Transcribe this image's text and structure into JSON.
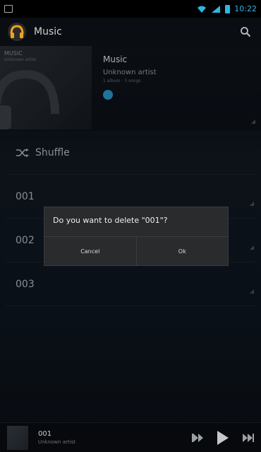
{
  "status": {
    "time": "10:22"
  },
  "actionbar": {
    "title": "Music"
  },
  "album": {
    "art_title": "MUSIC",
    "art_subtitle": "Unknown artist",
    "title": "Music",
    "artist": "Unknown artist",
    "info": "1 album · 3 songs"
  },
  "list": {
    "shuffle_label": "Shuffle",
    "items": [
      {
        "title": "001"
      },
      {
        "title": "002"
      },
      {
        "title": "003"
      }
    ]
  },
  "dialog": {
    "message": "Do you want to delete \"001\"?",
    "cancel": "Cancel",
    "ok": "Ok"
  },
  "nowplaying": {
    "title": "001",
    "artist": "Unknown artist"
  },
  "colors": {
    "accent": "#2fb5e4",
    "dialog_bg": "#2a2b2d"
  }
}
